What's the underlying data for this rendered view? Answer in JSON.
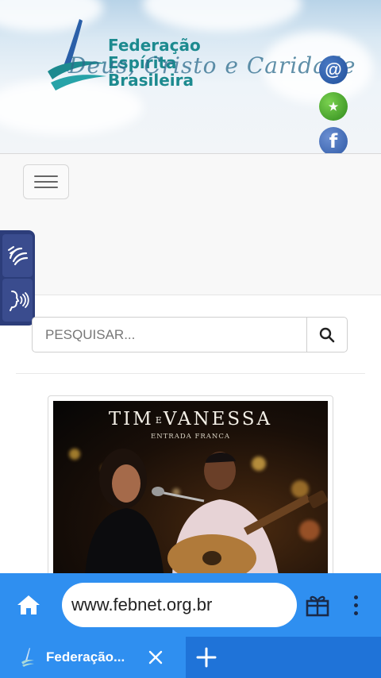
{
  "header": {
    "logo_lines": [
      "Federação",
      "Espírita",
      "Brasileira"
    ],
    "motto": "Deus, Cristo e Caridade",
    "social": [
      {
        "icon": "email-icon",
        "glyph": "@"
      },
      {
        "icon": "esperanto-star-icon",
        "glyph": "★"
      },
      {
        "icon": "facebook-icon",
        "glyph": "f"
      }
    ],
    "colors": {
      "brand": "#1c8a8f",
      "motto": "#2c6b8c"
    }
  },
  "accessibility": {
    "buttons": [
      {
        "icon": "sign-language-icon"
      },
      {
        "icon": "speech-reader-icon"
      }
    ],
    "color": "#2c3d7a"
  },
  "search": {
    "placeholder": "PESQUISAR...",
    "value": "",
    "button_icon": "search-icon"
  },
  "promo": {
    "title_left": "TIM",
    "title_joiner": "E",
    "title_right": "VANESSA",
    "subtitle": "ENTRADA FRANCA"
  },
  "browser": {
    "url": "www.febnet.org.br",
    "accent": "#2f8ff0",
    "tab_strip_color": "#1f73d8",
    "tabs": [
      {
        "title": "Federação..."
      }
    ],
    "icons": [
      "home-icon",
      "gift-icon",
      "more-vertical-icon",
      "close-icon",
      "plus-icon"
    ]
  }
}
